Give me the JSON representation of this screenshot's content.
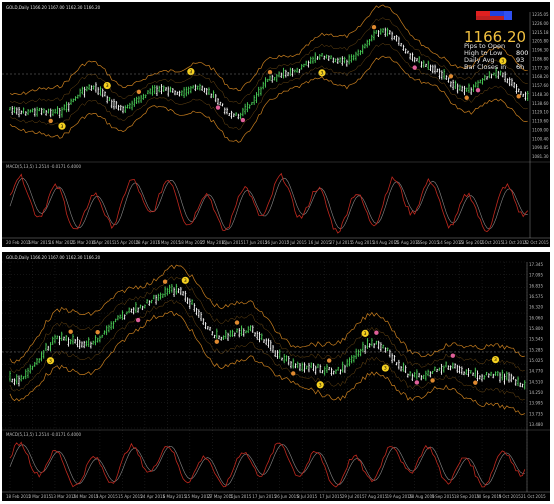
{
  "charts": [
    {
      "title": "GOLD,Daily  1166.20 1167.00 1162.30 1166.20",
      "indicator_label": "MACD(5,13,5) 1.2514 -0.0171 6.4000",
      "price_ticks": [
        "1235.05",
        "1226.00",
        "1215.18",
        "1205.80",
        "1196.30",
        "1186.80",
        "1177.30",
        "1168.20",
        "1157.60",
        "1148.30",
        "1138.60",
        "1129.10",
        "1119.60",
        "1109.00",
        "1100.40",
        "1090.85",
        "1081.30"
      ],
      "date_ticks": [
        "20 Feb 2015",
        "3 Mar 2015",
        "16 Mar 2015",
        "25 Mar 2015",
        "6 Apr 2015",
        "15 Apr 2015",
        "28 Apr 2015",
        "7 May 2015",
        "18 May 2015",
        "27 May 2015",
        "8 Jun 2015",
        "17 Jun 2015",
        "26 Jun 2015",
        "7 Jul 2015",
        "16 Jul 2015",
        "27 Jul 2015",
        "5 Aug 2015",
        "14 Aug 2015",
        "25 Aug 2015",
        "3 Sep 2015",
        "14 Sep 2015",
        "23 Sep 2015",
        "2 Oct 2015",
        "13 Oct 2015",
        "22 Oct 2015"
      ],
      "info": {
        "price": "1166.20",
        "pips_to_open_label": "Pips to Open",
        "pips_to_open": "0",
        "high_to_low_label": "High to Low",
        "high_to_low": "800",
        "daily_avg_label": "Daily Avg",
        "daily_avg": "93",
        "bar_closes_label": "Bar Closes in",
        "bar_closes": "6h"
      },
      "colors": {
        "bull": "#4cd45a",
        "bear": "#ffffff",
        "band": "#c87e1e",
        "macd_main": "#c0281e",
        "macd_signal": "#8a8a8a",
        "marker_yellow": "#f5d020",
        "marker_pink": "#e0609a",
        "marker_orange": "#e08a30"
      }
    },
    {
      "title": "GOLD,Daily  1166.20 1167.00 1162.30 1166.20",
      "indicator_label": "MACD(5,13,5) 1.2514 -0.0171 6.4000",
      "price_ticks": [
        "17.345",
        "17.095",
        "16.835",
        "16.575",
        "16.320",
        "16.060",
        "15.800",
        "15.545",
        "15.285",
        "15.025",
        "14.770",
        "14.510",
        "14.250",
        "13.995",
        "13.735",
        "13.480"
      ],
      "date_ticks": [
        "18 Feb 2015",
        "2 Mar 2015",
        "13 Mar 2015",
        "24 Mar 2015",
        "3 Apr 2015",
        "15 Apr 2015",
        "24 Apr 2015",
        "6 May 2015",
        "15 May 2015",
        "27 May 2015",
        "5 Jun 2015",
        "17 Jun 2015",
        "26 Jun 2015",
        "8 Jul 2015",
        "17 Jul 2015",
        "29 Jul 2015",
        "7 Aug 2015",
        "19 Aug 2015",
        "28 Aug 2015",
        "9 Sep 2015",
        "18 Sep 2015",
        "30 Sep 2015",
        "9 Oct 2015",
        "21 Oct 2015"
      ],
      "colors": {
        "bull": "#4cd45a",
        "bear": "#ffffff",
        "band": "#c87e1e",
        "macd_main": "#c0281e",
        "macd_signal": "#8a8a8a",
        "marker_yellow": "#f5d020",
        "marker_pink": "#e0609a",
        "marker_orange": "#e08a30"
      }
    }
  ]
}
